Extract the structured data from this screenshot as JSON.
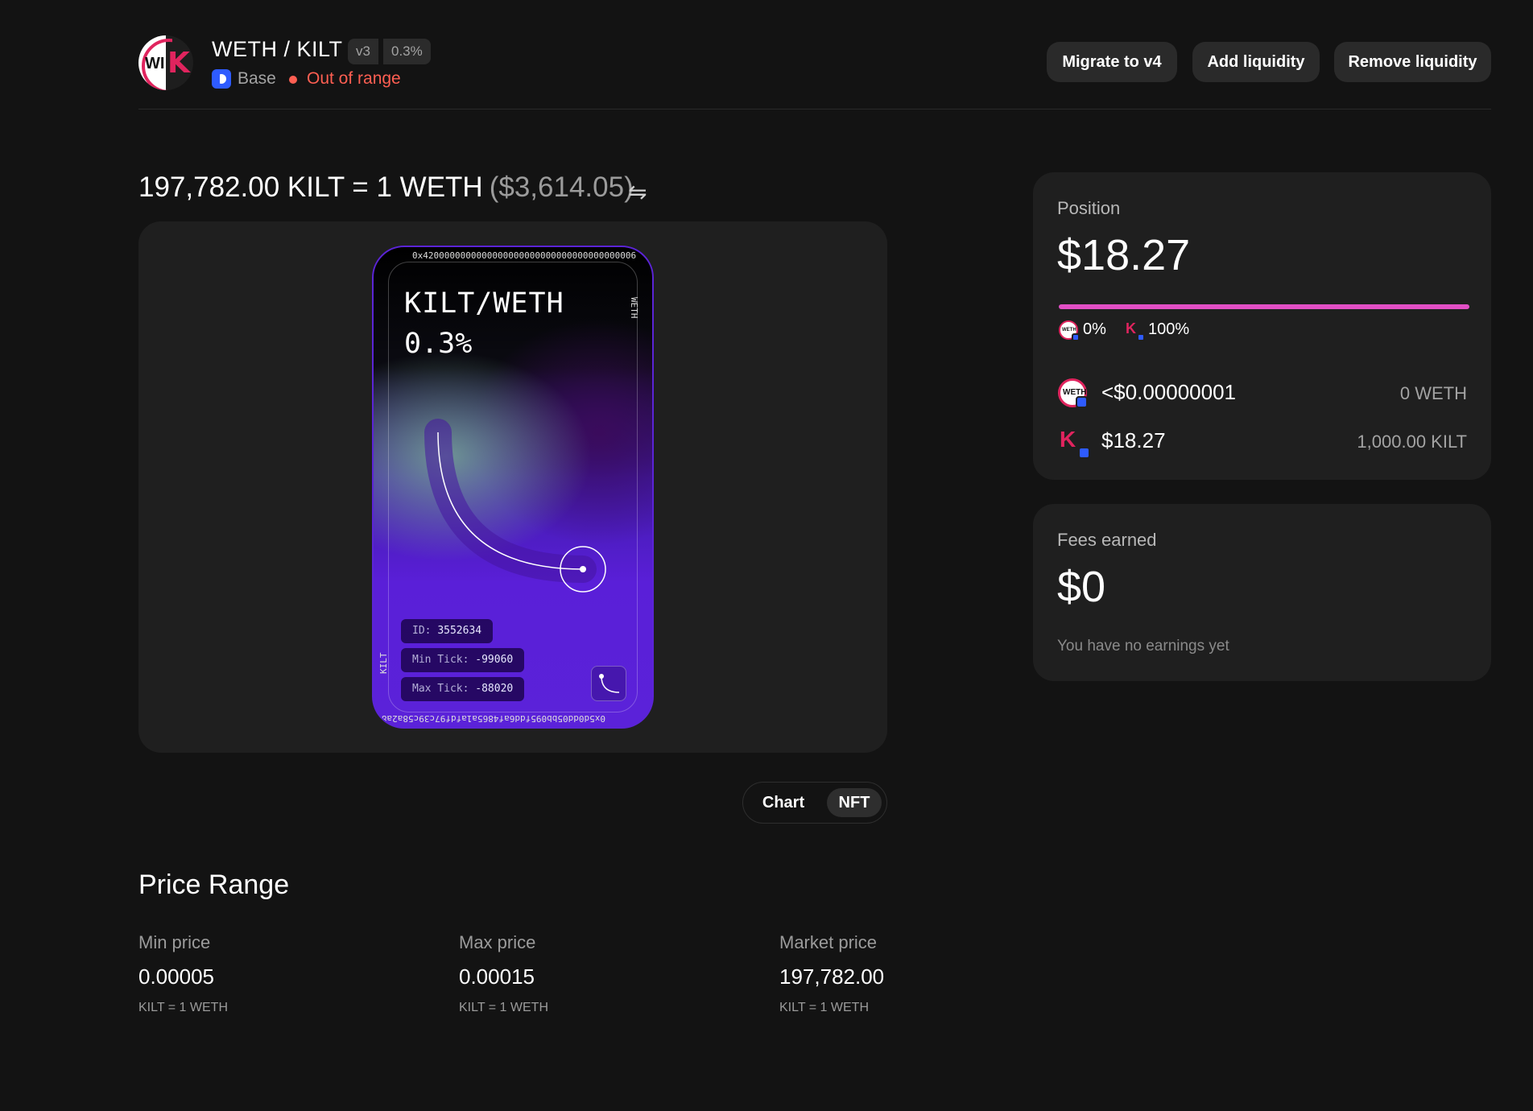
{
  "header": {
    "pair": "WETH / KILT",
    "version": "v3",
    "fee_tier": "0.3%",
    "chain": "Base",
    "status": "Out of range",
    "buttons": {
      "migrate": "Migrate to v4",
      "add": "Add liquidity",
      "remove": "Remove liquidity"
    },
    "logo_text": "WI",
    "logo_k": "K"
  },
  "price": {
    "rate": "197,782.00 KILT = 1 WETH",
    "usd": "($3,614.05)",
    "swap_icon": "⇋"
  },
  "nft": {
    "title": "KILT/WETH",
    "fee": "0.3%",
    "top_address": "0x4200000000000000000000000000000000000006",
    "right_label": "WETH",
    "left_label": "KILT",
    "bottom_address": "0x5d0dd05bb095fdd6af4865a1afdf97c39c58a2a8",
    "id_label": "ID:",
    "id_value": "3552634",
    "min_tick_label": "Min Tick:",
    "min_tick_value": "-99060",
    "max_tick_label": "Max Tick:",
    "max_tick_value": "-88020",
    "colors": {
      "purple": "#5b22d9",
      "green": "#78aa96"
    }
  },
  "view_toggle": {
    "chart": "Chart",
    "nft": "NFT",
    "selected": "NFT"
  },
  "price_range": {
    "title": "Price Range",
    "min": {
      "label": "Min price",
      "value": "0.00005",
      "unit": "KILT = 1 WETH"
    },
    "max": {
      "label": "Max price",
      "value": "0.00015",
      "unit": "KILT = 1 WETH"
    },
    "market": {
      "label": "Market price",
      "value": "197,782.00",
      "unit": "KILT = 1 WETH"
    }
  },
  "position": {
    "label": "Position",
    "value": "$18.27",
    "weth_pct": "0%",
    "kilt_pct": "100%",
    "kilt_share": 1.0,
    "tokens": [
      {
        "symbol": "WETH",
        "usd": "<$0.00000001",
        "amount": "0 WETH",
        "icon": "weth-icon"
      },
      {
        "symbol": "KILT",
        "usd": "$18.27",
        "amount": "1,000.00 KILT",
        "icon": "kilt-icon"
      }
    ],
    "bar_color": "#e24fc5"
  },
  "fees": {
    "label": "Fees earned",
    "value": "$0",
    "note": "You have no earnings yet"
  },
  "colors": {
    "background": "#131313",
    "card": "#1f1f1f",
    "danger": "#ff5f52",
    "accent_pink": "#e0245e",
    "base_blue": "#2e5bff"
  }
}
